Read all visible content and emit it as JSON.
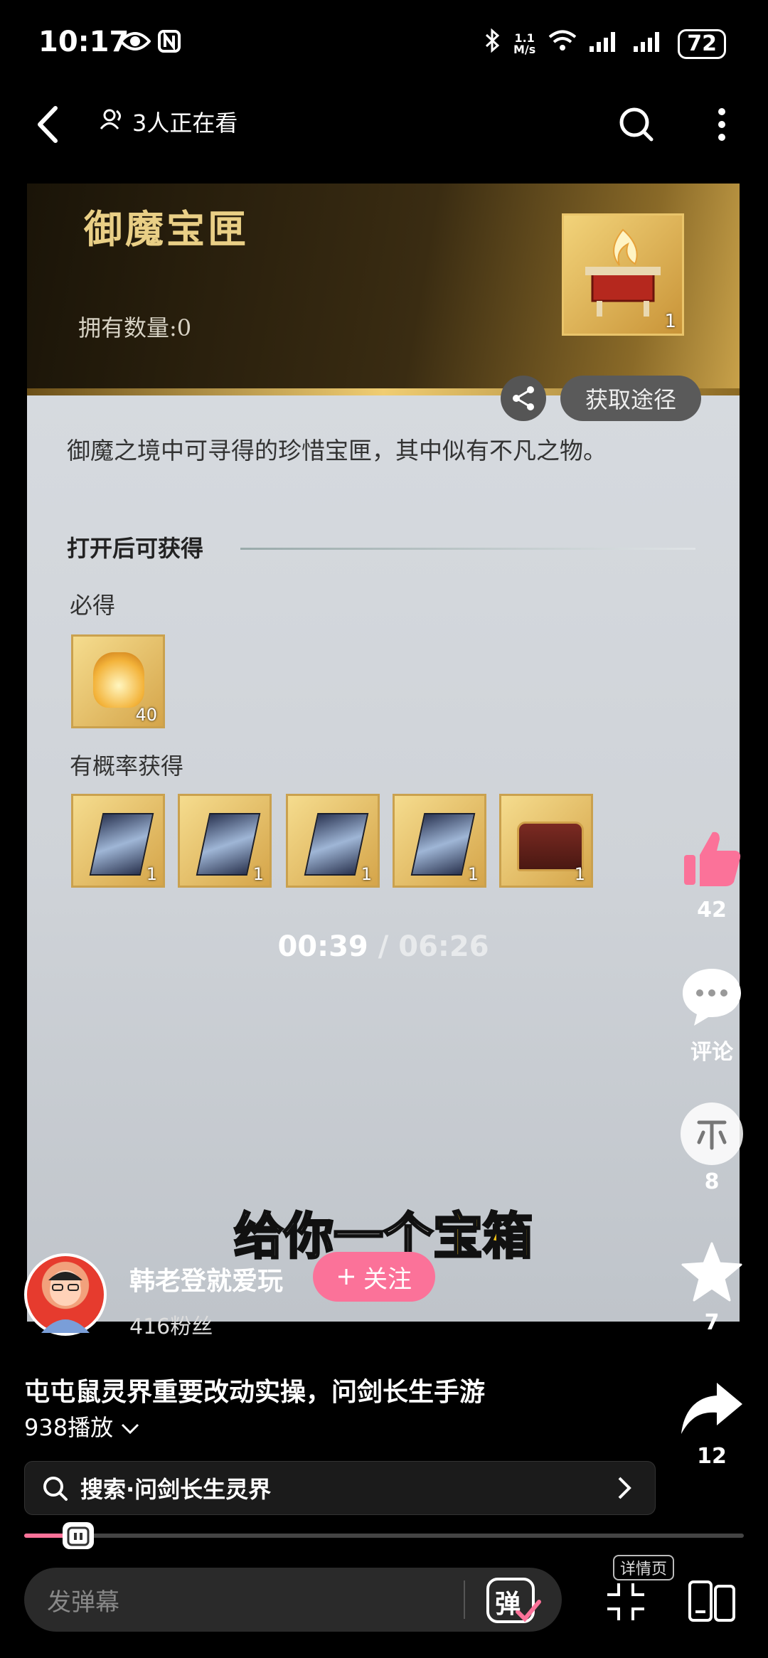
{
  "status_bar": {
    "time": "10:17",
    "net_speed_value": "1.1",
    "net_speed_unit": "M/s",
    "battery": "72"
  },
  "top_bar": {
    "viewers": "3人正在看"
  },
  "video": {
    "card": {
      "title": "御魔宝匣",
      "count_label": "拥有数量:0",
      "item_qty": "1",
      "obtain_label": "获取途径",
      "description": "御魔之境中可寻得的珍惜宝匣，其中似有不凡之物。",
      "section_title": "打开后可获得",
      "guaranteed_label": "必得",
      "guaranteed_items": [
        {
          "qty": "40"
        }
      ],
      "chance_label": "有概率获得",
      "chance_items": [
        {
          "qty": "1"
        },
        {
          "qty": "1"
        },
        {
          "qty": "1"
        },
        {
          "qty": "1"
        },
        {
          "qty": "1"
        }
      ]
    },
    "time_current": "00:39",
    "time_separator": " / ",
    "time_total": "06:26",
    "subtitle_prefix": "给你一个",
    "subtitle_highlight": "宝箱"
  },
  "uploader": {
    "name": "韩老登就爱玩",
    "follow_label": "关注",
    "fans": "416粉丝"
  },
  "actions": {
    "likes": "42",
    "comment_label": "评论",
    "coins": "8",
    "favorites": "7",
    "shares": "12"
  },
  "info": {
    "title": "屯屯鼠灵界重要改动实操，问剑长生手游",
    "plays": "938播放"
  },
  "search": {
    "text": "搜索·问剑长生灵界"
  },
  "progress": {
    "fraction": 0.075
  },
  "bottom_bar": {
    "danmaku_placeholder": "发弹幕",
    "danmaku_toggle": "弹",
    "detail_label": "详情页"
  },
  "colors": {
    "accent": "#fb7299",
    "gold": "#f5c518"
  }
}
